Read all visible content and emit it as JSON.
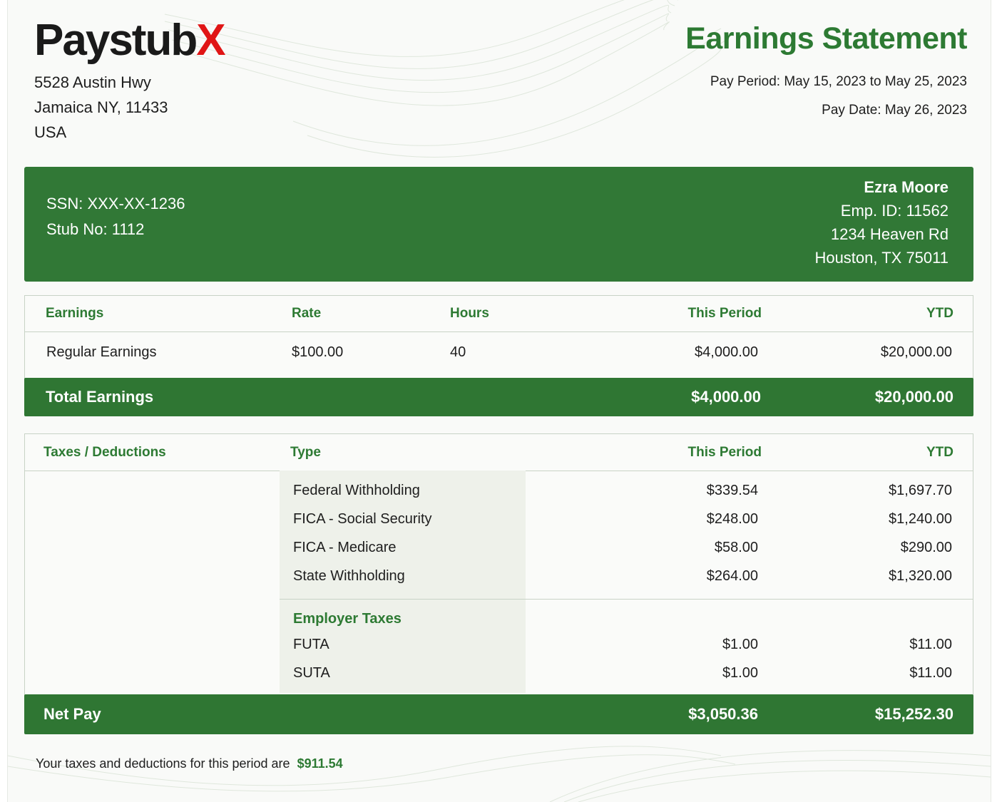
{
  "company": {
    "logo_main": "Paystub",
    "logo_accent": "X",
    "address_line1": "5528 Austin Hwy",
    "address_line2": "Jamaica NY, 11433",
    "address_line3": "USA"
  },
  "statement": {
    "title": "Earnings Statement",
    "pay_period": "Pay Period: May 15, 2023 to May 25, 2023",
    "pay_date": "Pay Date: May 26, 2023"
  },
  "employee": {
    "ssn": "SSN: XXX-XX-1236",
    "stub_no": "Stub No: 1112",
    "name": "Ezra Moore",
    "emp_id": "Emp. ID: 11562",
    "address_line1": "1234 Heaven Rd",
    "address_line2": "Houston, TX 75011"
  },
  "earnings": {
    "headers": {
      "earnings": "Earnings",
      "rate": "Rate",
      "hours": "Hours",
      "this_period": "This Period",
      "ytd": "YTD"
    },
    "rows": [
      {
        "label": "Regular Earnings",
        "rate": "$100.00",
        "hours": "40",
        "this_period": "$4,000.00",
        "ytd": "$20,000.00"
      }
    ],
    "total": {
      "label": "Total Earnings",
      "this_period": "$4,000.00",
      "ytd": "$20,000.00"
    }
  },
  "deductions": {
    "headers": {
      "taxes": "Taxes / Deductions",
      "type": "Type",
      "this_period": "This Period",
      "ytd": "YTD"
    },
    "rows": [
      {
        "type": "Federal Withholding",
        "this_period": "$339.54",
        "ytd": "$1,697.70"
      },
      {
        "type": "FICA - Social Security",
        "this_period": "$248.00",
        "ytd": "$1,240.00"
      },
      {
        "type": "FICA - Medicare",
        "this_period": "$58.00",
        "ytd": "$290.00"
      },
      {
        "type": "State Withholding",
        "this_period": "$264.00",
        "ytd": "$1,320.00"
      }
    ],
    "employer_heading": "Employer Taxes",
    "employer_rows": [
      {
        "type": "FUTA",
        "this_period": "$1.00",
        "ytd": "$11.00"
      },
      {
        "type": "SUTA",
        "this_period": "$1.00",
        "ytd": "$11.00"
      }
    ]
  },
  "net_pay": {
    "label": "Net Pay",
    "this_period": "$3,050.36",
    "ytd": "$15,252.30"
  },
  "footer": {
    "text": "Your taxes and deductions for this period are",
    "amount": "$911.54"
  },
  "colors": {
    "brand_green": "#317836",
    "accent_red": "#e01515"
  }
}
